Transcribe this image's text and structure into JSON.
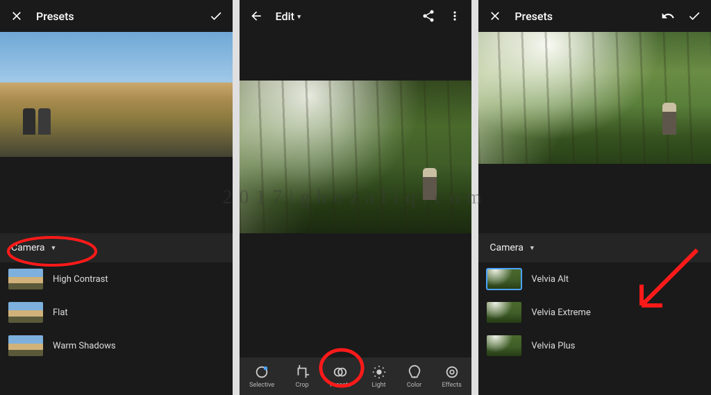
{
  "watermark": "2017|ghozaliq.com",
  "screen1": {
    "title": "Presets",
    "category": "Camera",
    "presets": [
      {
        "label": "High Contrast"
      },
      {
        "label": "Flat"
      },
      {
        "label": "Warm Shadows"
      }
    ]
  },
  "screen2": {
    "title": "Edit",
    "tools": [
      {
        "label": "Selective",
        "icon": "selective"
      },
      {
        "label": "Crop",
        "icon": "crop"
      },
      {
        "label": "Presets",
        "icon": "presets"
      },
      {
        "label": "Light",
        "icon": "light"
      },
      {
        "label": "Color",
        "icon": "color"
      },
      {
        "label": "Effects",
        "icon": "effects"
      }
    ]
  },
  "screen3": {
    "title": "Presets",
    "category": "Camera",
    "presets": [
      {
        "label": "Velvia Alt",
        "selected": true
      },
      {
        "label": "Velvia Extreme"
      },
      {
        "label": "Velvia Plus"
      }
    ]
  }
}
